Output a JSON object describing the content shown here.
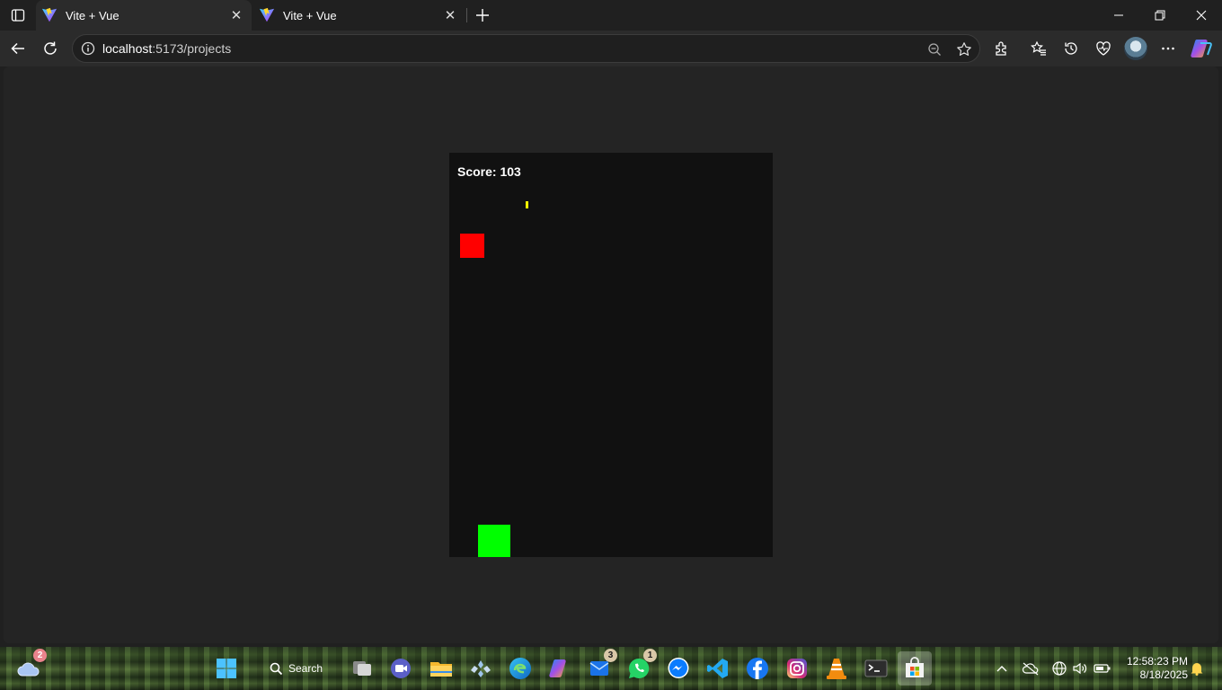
{
  "browser": {
    "tabs": [
      {
        "title": "Vite + Vue",
        "active": true
      },
      {
        "title": "Vite + Vue",
        "active": false
      }
    ],
    "address": {
      "host": "localhost",
      "rest": ":5173/projects"
    }
  },
  "game": {
    "score_text": "Score: 103",
    "colors": {
      "background": "#111111",
      "enemy": "#ff0000",
      "player": "#00ff00",
      "bullet": "#ffff00"
    }
  },
  "taskbar": {
    "search_label": "Search",
    "weather_badge": "2",
    "mail_badge": "3",
    "whatsapp_badge": "1",
    "time": "12:58:23 PM",
    "date": "8/18/2025"
  }
}
